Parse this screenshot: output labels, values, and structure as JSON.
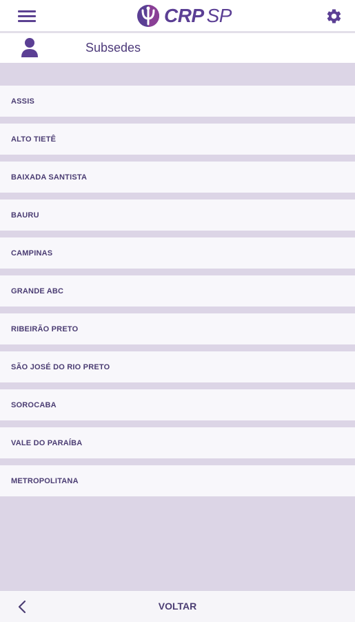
{
  "header": {
    "menu_icon": "hamburger-menu-icon",
    "logo": {
      "brand": "CRP",
      "region": "SP",
      "emblem": "psi-emblem"
    },
    "settings_icon": "gear-icon"
  },
  "subheader": {
    "icon": "user-icon",
    "title": "Subsedes"
  },
  "list": {
    "items": [
      {
        "label": "ASSIS"
      },
      {
        "label": "ALTO TIETÊ"
      },
      {
        "label": "BAIXADA SANTISTA"
      },
      {
        "label": "BAURU"
      },
      {
        "label": "CAMPINAS"
      },
      {
        "label": "GRANDE ABC"
      },
      {
        "label": "RIBEIRÃO PRETO"
      },
      {
        "label": "SÃO JOSÉ DO RIO PRETO"
      },
      {
        "label": "SOROCABA"
      },
      {
        "label": "VALE DO PARAÍBA"
      },
      {
        "label": "METROPOLITANA"
      }
    ]
  },
  "footer": {
    "back_icon": "chevron-left-icon",
    "back_label": "VOLTAR"
  },
  "colors": {
    "brand_purple": "#5b3f94",
    "background": "#dcd5e6",
    "item_background": "#f8f7fb"
  }
}
